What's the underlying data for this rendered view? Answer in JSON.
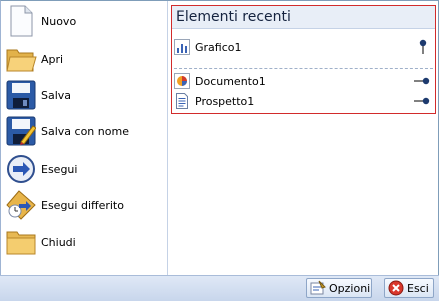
{
  "commands": [
    {
      "label": "Nuovo",
      "icon": "new-document-icon"
    },
    {
      "label": "Apri",
      "icon": "open-folder-icon"
    },
    {
      "label": "Salva",
      "icon": "save-disk-icon"
    },
    {
      "label": "Salva con nome",
      "icon": "save-as-icon"
    },
    {
      "label": "Esegui",
      "icon": "run-arrow-icon"
    },
    {
      "label": "Esegui differito",
      "icon": "run-deferred-icon"
    },
    {
      "label": "Chiudi",
      "icon": "close-folder-icon"
    }
  ],
  "recent": {
    "title": "Elementi recenti",
    "pinned": [
      {
        "label": "Grafico1",
        "icon": "chart-icon",
        "pinned": true
      }
    ],
    "items": [
      {
        "label": "Documento1",
        "icon": "document-icon",
        "pinned": false
      },
      {
        "label": "Prospetto1",
        "icon": "report-icon",
        "pinned": false
      }
    ]
  },
  "footer": {
    "options_label": "Opzioni",
    "exit_label": "Esci"
  },
  "colors": {
    "accent_border": "#d22b2b",
    "panel_border": "#7f9db9"
  }
}
